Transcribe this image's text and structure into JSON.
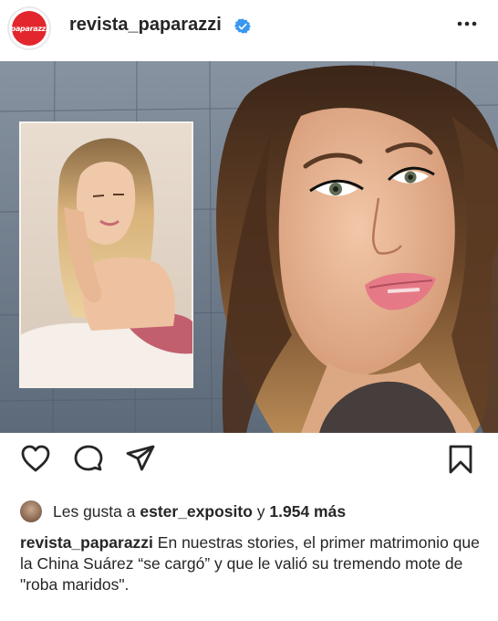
{
  "header": {
    "avatar_text": "paparazzi",
    "username": "revista_paparazzi",
    "verified_icon": "verified-badge-icon",
    "more_icon": "more-options-icon"
  },
  "post": {
    "image_description_icon": "post-photo"
  },
  "actions": {
    "like_icon": "heart-icon",
    "comment_icon": "comment-icon",
    "share_icon": "send-icon",
    "save_icon": "bookmark-icon"
  },
  "likes": {
    "prefix": "Les gusta a",
    "user": "ester_exposito",
    "connector": "y",
    "count": "1.954 más"
  },
  "caption": {
    "username": "revista_paparazzi",
    "text": "En nuestras stories, el primer matrimonio que la China Suárez “se cargó” y que le valió su tremendo mote de \"roba maridos\"."
  },
  "colors": {
    "brand_red": "#e3262e",
    "verified_blue": "#3897f0",
    "text": "#262626"
  }
}
